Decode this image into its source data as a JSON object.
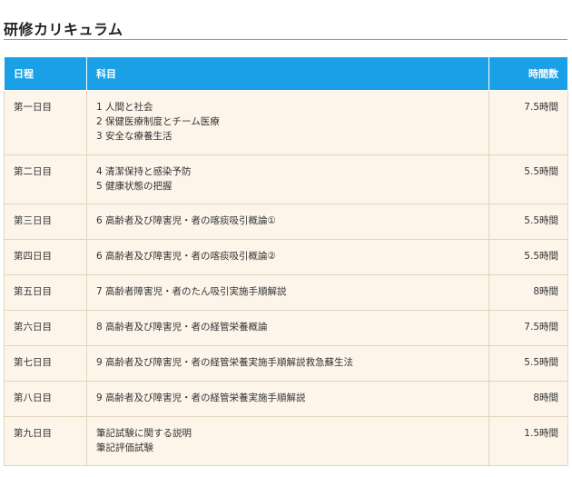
{
  "page": {
    "title": "研修カリキュラム"
  },
  "table": {
    "headers": {
      "day": "日程",
      "subject": "科目",
      "hours": "時間数"
    },
    "rows": [
      {
        "day": "第一日目",
        "subjects": [
          "1 人間と社会",
          "2 保健医療制度とチーム医療",
          "3 安全な療養生活"
        ],
        "hours": "7.5時間"
      },
      {
        "day": "第二日目",
        "subjects": [
          "4 清潔保持と感染予防",
          "5 健康状態の把握"
        ],
        "hours": "5.5時間"
      },
      {
        "day": "第三日目",
        "subjects": [
          "6 高齢者及び障害児・者の喀痰吸引概論①"
        ],
        "hours": "5.5時間"
      },
      {
        "day": "第四日目",
        "subjects": [
          "6 高齢者及び障害児・者の喀痰吸引概論②"
        ],
        "hours": "5.5時間"
      },
      {
        "day": "第五日目",
        "subjects": [
          "7 高齢者障害児・者のたん吸引実施手順解説"
        ],
        "hours": "8時間"
      },
      {
        "day": "第六日目",
        "subjects": [
          "8 高齢者及び障害児・者の経管栄養概論"
        ],
        "hours": "7.5時間"
      },
      {
        "day": "第七日目",
        "subjects": [
          "9 高齢者及び障害児・者の経管栄養実施手順解説救急蘇生法"
        ],
        "hours": "5.5時間"
      },
      {
        "day": "第八日目",
        "subjects": [
          "9 高齢者及び障害児・者の経管栄養実施手順解説"
        ],
        "hours": "8時間"
      },
      {
        "day": "第九日目",
        "subjects": [
          "筆記試験に関する説明",
          "筆記評価試験"
        ],
        "hours": "1.5時間"
      }
    ]
  },
  "colors": {
    "header_bg": "#1aa0e6",
    "row_bg": "#fdf5ea",
    "border": "#e4d4bc"
  }
}
